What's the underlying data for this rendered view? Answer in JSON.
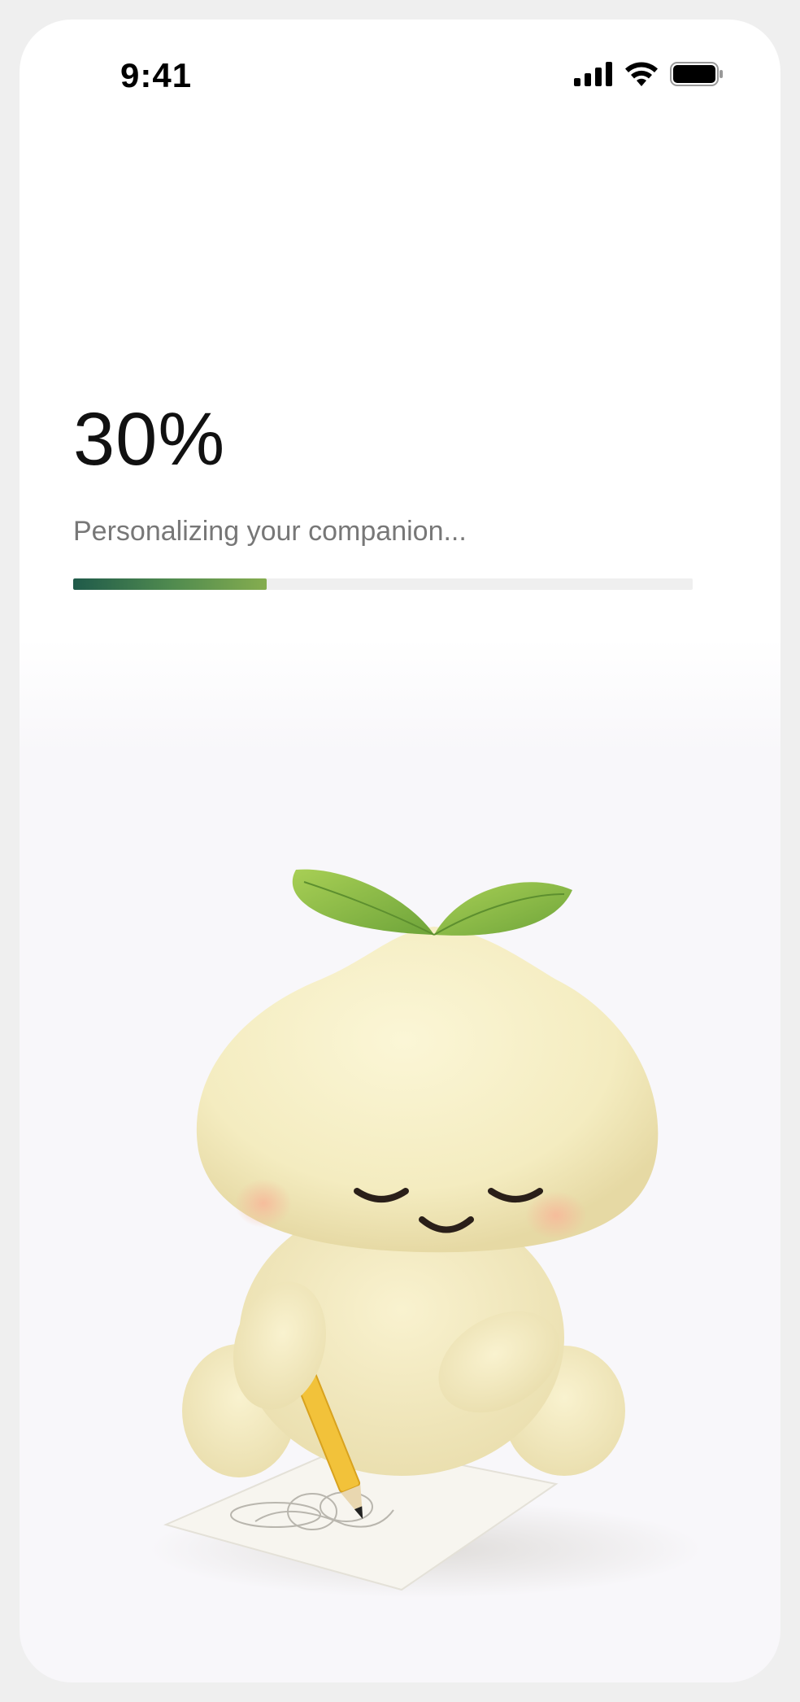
{
  "status_bar": {
    "time": "9:41",
    "icons": [
      "cellular-signal-icon",
      "wifi-icon",
      "battery-icon"
    ]
  },
  "progress": {
    "percent_text": "30%",
    "value": 0.3125,
    "label": "Personalizing your companion..."
  },
  "colors": {
    "progress_start": "#1f5a4a",
    "progress_end": "#85ad4f",
    "track": "#efefef",
    "label": "#777777"
  },
  "illustration": {
    "subject": "mascot-drawing-icon"
  }
}
